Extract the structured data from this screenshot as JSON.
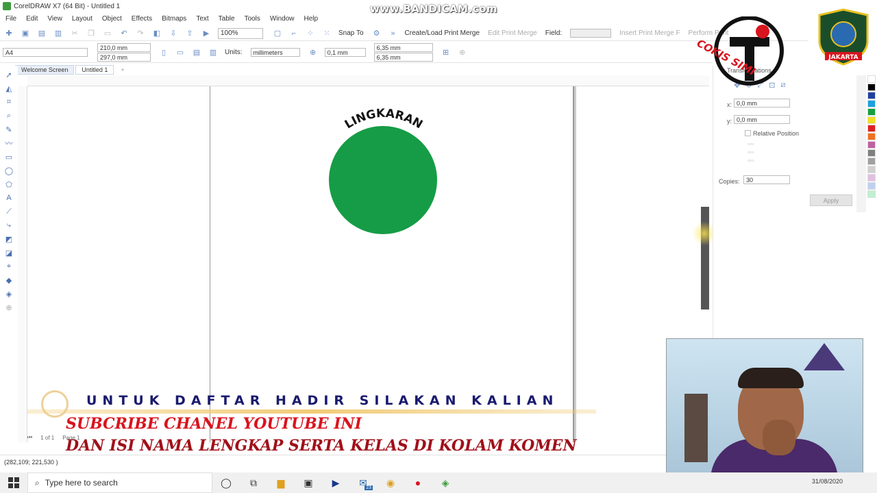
{
  "window": {
    "title": "CorelDRAW X7 (64 Bit) - Untitled 1",
    "watermark": "www.BANDICAM.com"
  },
  "menu": [
    "File",
    "Edit",
    "View",
    "Layout",
    "Object",
    "Effects",
    "Bitmaps",
    "Text",
    "Table",
    "Tools",
    "Window",
    "Help"
  ],
  "toolbar": {
    "zoom": "100%",
    "snap_to": "Snap To",
    "print_merge": "Create/Load Print Merge",
    "edit_print_merge": "Edit Print Merge",
    "field_label": "Field:",
    "insert_merge": "Insert Print Merge F",
    "perform_print": "Perform Print"
  },
  "propbar": {
    "page_size": "A4",
    "width": "210,0 mm",
    "height": "297,0 mm",
    "units_label": "Units:",
    "units_value": "millimeters",
    "nudge": "0,1 mm",
    "dup_x": "6,35 mm",
    "dup_y": "6,35 mm"
  },
  "tabs": [
    "Welcome Screen",
    "Untitled 1"
  ],
  "canvas": {
    "circle_color": "#169c46",
    "arc_text": "LINGKARAN"
  },
  "docker": {
    "title": "Transformations",
    "x_value": "0,0 mm",
    "y_value": "0,0 mm",
    "relative_position": "Relative Position",
    "copies_label": "Copies:",
    "copies_value": "30",
    "apply": "Apply"
  },
  "banner": {
    "line1": "UNTUK DAFTAR HADIR SILAKAN KALIAN",
    "line2": "SUBCRIBE CHANEL YOUTUBE INI",
    "line3": "DAN ISI NAMA LENGKAP SERTA KELAS DI KOLAM KOMEN"
  },
  "status": {
    "coords": "(282,109; 221,530 )",
    "page_nav": "1 of 1",
    "page_tab": "Page 1"
  },
  "logo": {
    "channel_text": "COKIS SIMI",
    "school_text": "JAKARTA"
  },
  "taskbar": {
    "search_placeholder": "Type here to search",
    "mail_badge": "23",
    "date": "31/08/2020"
  },
  "palette": [
    "#ffffff",
    "#000000",
    "#1f3fa0",
    "#1aa0e0",
    "#15a040",
    "#f0e020",
    "#e02020",
    "#f07020",
    "#c060a0",
    "#808080",
    "#a0a0a0",
    "#d0d0d0",
    "#e0c0e0",
    "#c0d0f0",
    "#c0f0d0"
  ]
}
